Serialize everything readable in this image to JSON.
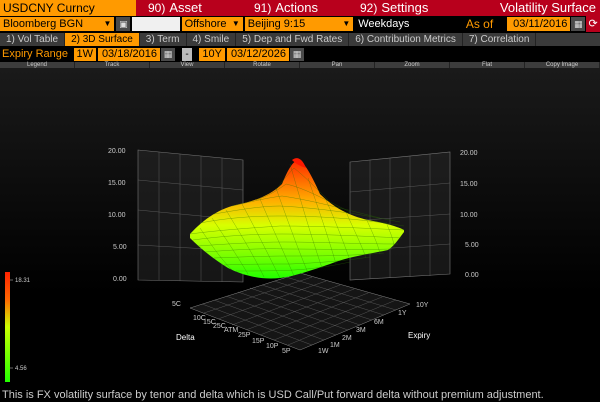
{
  "header": {
    "ticker": "USDCNY Curncy",
    "menu": [
      {
        "num": "90)",
        "label": "Asset"
      },
      {
        "num": "91)",
        "label": "Actions"
      },
      {
        "num": "92)",
        "label": "Settings"
      }
    ],
    "title": "Volatility Surface"
  },
  "selectors": {
    "source": "Bloomberg BGN",
    "market": "Offshore",
    "time": "Beijing 9:15",
    "days": "Weekdays",
    "as_of_label": "As of",
    "as_of_date": "03/11/2016"
  },
  "tabs": [
    {
      "label": "1) Vol Table",
      "active": false
    },
    {
      "label": "2) 3D Surface",
      "active": true
    },
    {
      "label": "3) Term",
      "active": false
    },
    {
      "label": "4) Smile",
      "active": false
    },
    {
      "label": "5) Dep and Fwd Rates",
      "active": false
    },
    {
      "label": "6) Contribution Metrics",
      "active": false
    },
    {
      "label": "7) Correlation",
      "active": false
    }
  ],
  "expiry": {
    "label": "Expiry Range",
    "start_tenor": "1W",
    "start_date": "03/18/2016",
    "separator": "-",
    "end_tenor": "10Y",
    "end_date": "03/12/2026"
  },
  "toolbar": [
    "Legend",
    "Track",
    "View",
    "Rotate",
    "Pan",
    "Zoom",
    "Flat",
    "Copy Image"
  ],
  "chart_data": {
    "type": "surface",
    "z_ticks": [
      "0.00",
      "5.00",
      "10.00",
      "15.00",
      "20.00"
    ],
    "z_range": [
      0,
      20
    ],
    "delta_ticks": [
      "5C",
      "10C",
      "15C",
      "25C",
      "ATM",
      "25P",
      "15P",
      "10P",
      "5P"
    ],
    "delta_title": "Delta",
    "expiry_ticks": [
      "1W",
      "1M",
      "2M",
      "3M",
      "6M",
      "1Y",
      "10Y"
    ],
    "expiry_title": "Expiry",
    "colorbar": {
      "max": "18.31",
      "min": "4.56"
    },
    "colors": {
      "low": "#22ff00",
      "mid": "#b8ff00",
      "high": "#ff2a00"
    },
    "expiry_values": [
      0.02,
      0.08,
      0.17,
      0.25,
      0.5,
      1,
      10
    ],
    "delta_values": [
      5,
      10,
      15,
      25,
      50,
      75,
      85,
      90,
      95
    ]
  },
  "footnote": "This is FX volatility surface by tenor and delta which is USD Call/Put forward delta without premium adjustment."
}
